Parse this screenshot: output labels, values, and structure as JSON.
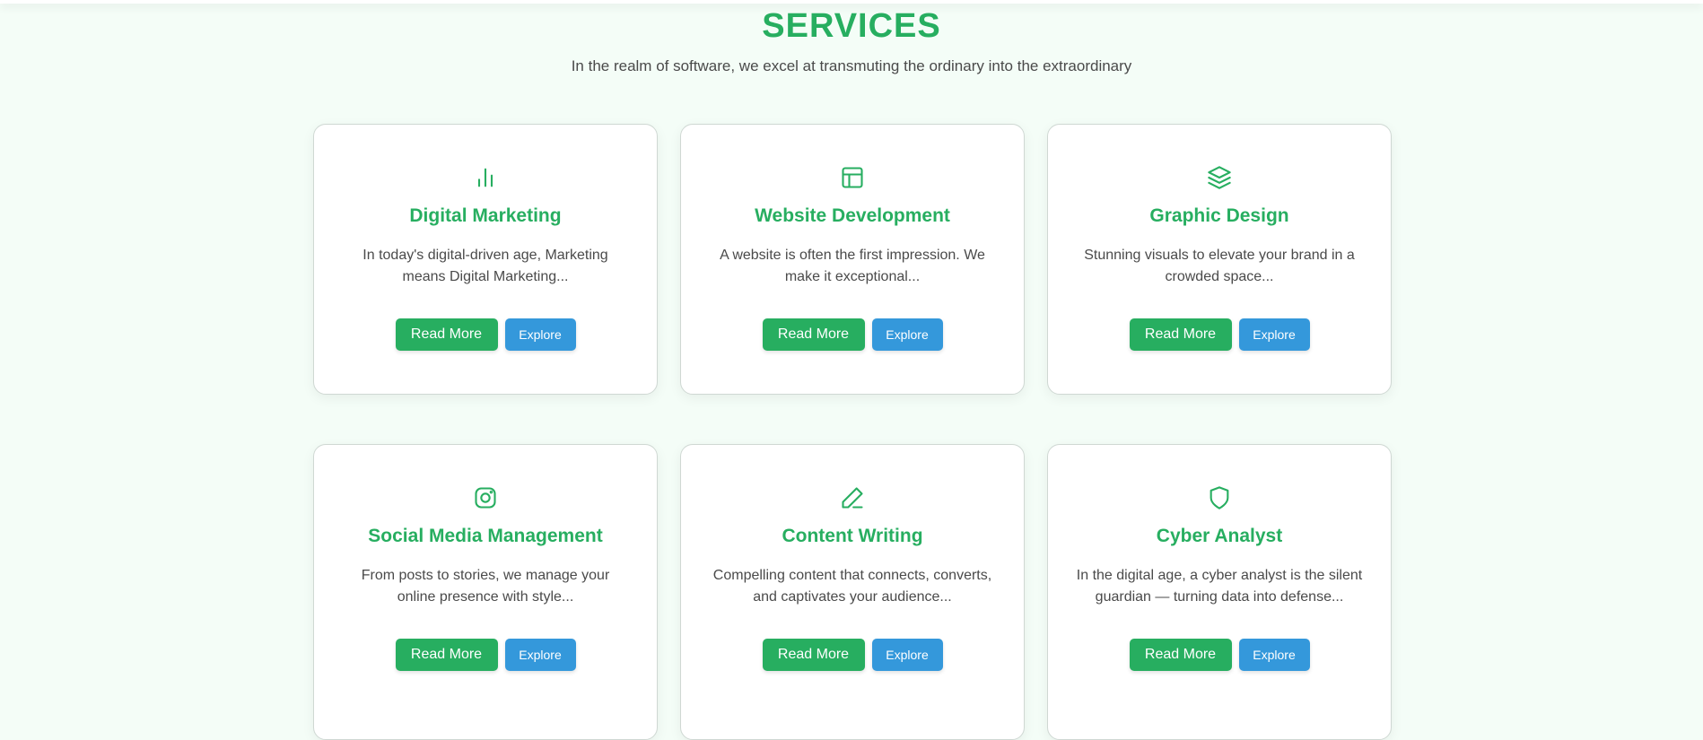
{
  "header": {
    "title": "SERVICES",
    "subtitle": "In the realm of software, we excel at transmuting the ordinary into the extraordinary"
  },
  "colors": {
    "accent_green": "#27ae60",
    "accent_blue": "#3498db",
    "background": "#f4fdf7"
  },
  "services": [
    {
      "icon": "bar-chart-icon",
      "title": "Digital Marketing",
      "description": "In today's digital-driven age, Marketing means Digital Marketing...",
      "read_more_label": "Read More",
      "explore_label": "Explore"
    },
    {
      "icon": "layout-icon",
      "title": "Website Development",
      "description": "A website is often the first impression. We make it exceptional...",
      "read_more_label": "Read More",
      "explore_label": "Explore"
    },
    {
      "icon": "layers-icon",
      "title": "Graphic Design",
      "description": "Stunning visuals to elevate your brand in a crowded space...",
      "read_more_label": "Read More",
      "explore_label": "Explore"
    },
    {
      "icon": "instagram-icon",
      "title": "Social Media Management",
      "description": "From posts to stories, we manage your online presence with style...",
      "read_more_label": "Read More",
      "explore_label": "Explore"
    },
    {
      "icon": "pen-icon",
      "title": "Content Writing",
      "description": "Compelling content that connects, converts, and captivates your audience...",
      "read_more_label": "Read More",
      "explore_label": "Explore"
    },
    {
      "icon": "shield-icon",
      "title": "Cyber Analyst",
      "description": "In the digital age, a cyber analyst is the silent guardian — turning data into defense...",
      "read_more_label": "Read More",
      "explore_label": "Explore"
    }
  ]
}
